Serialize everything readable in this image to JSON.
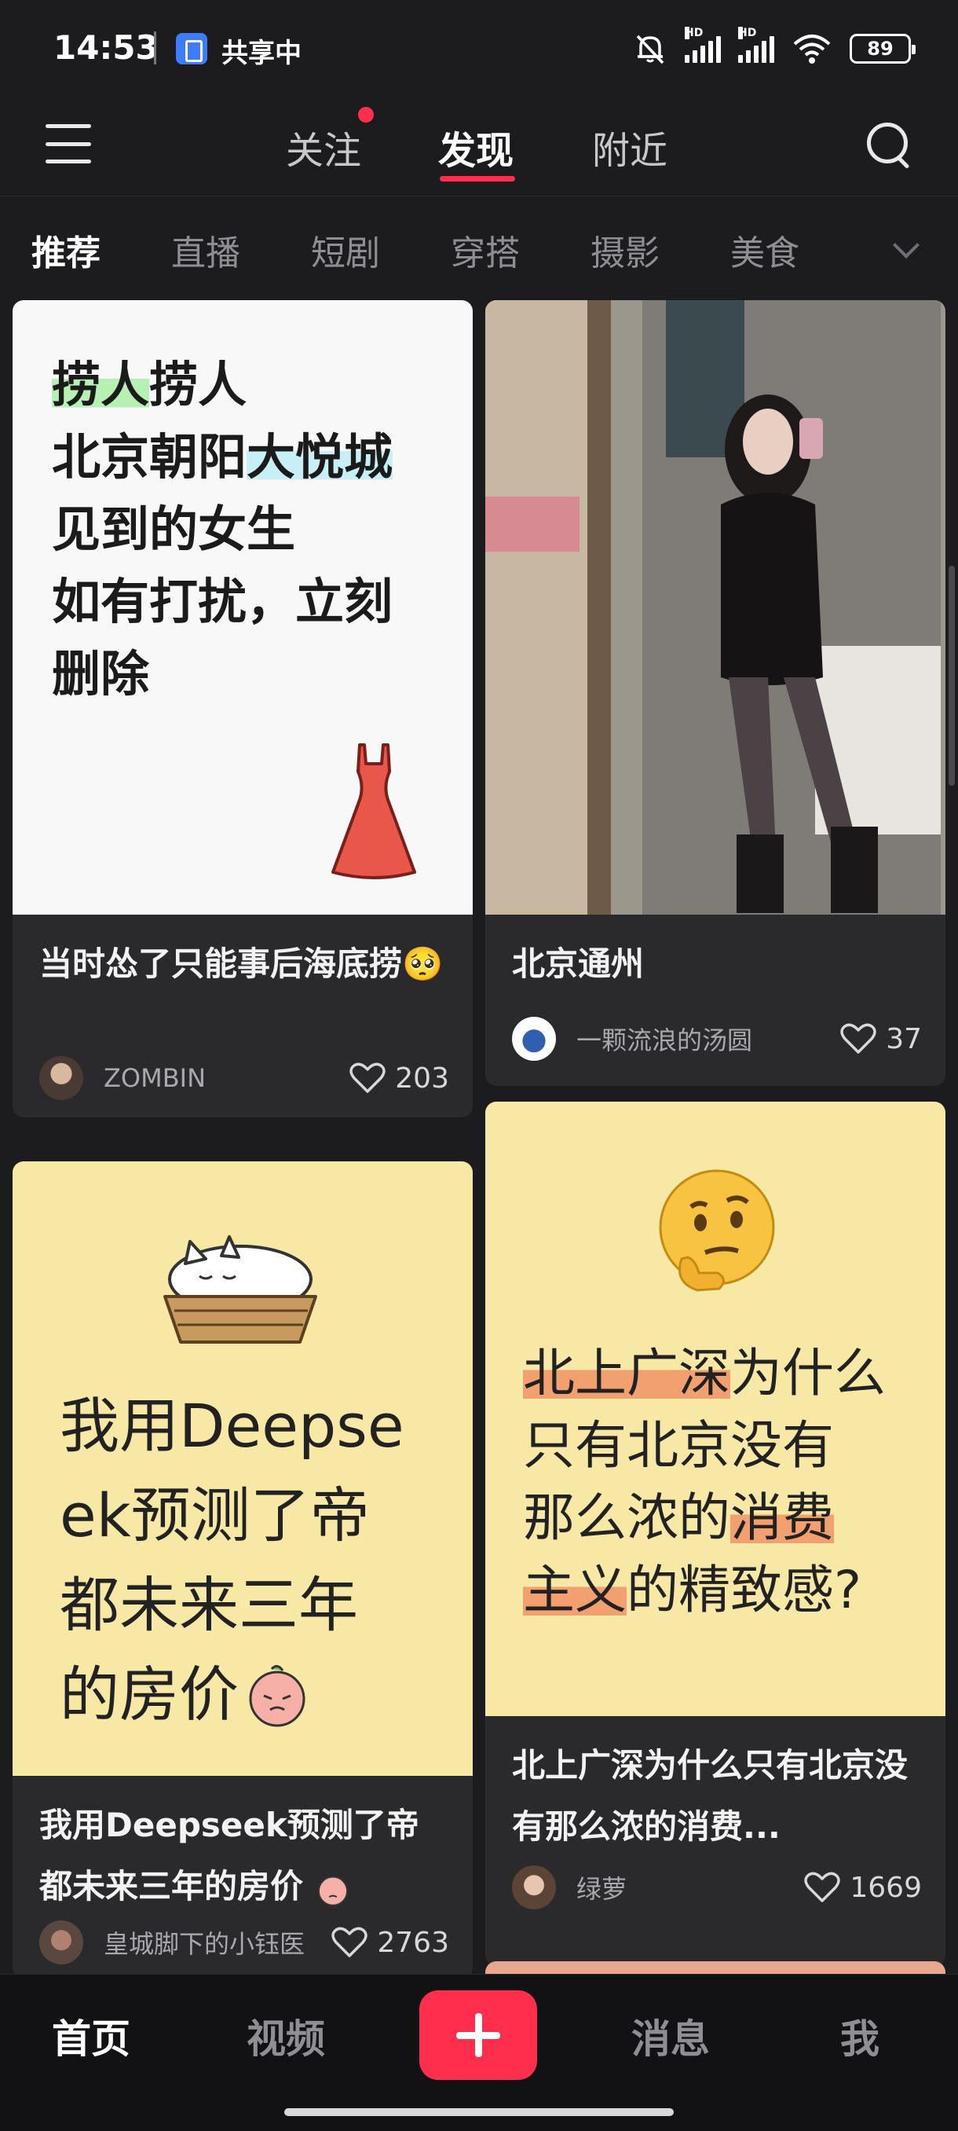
{
  "status_bar": {
    "time": "14:53",
    "share_label": "共享中",
    "battery": "89",
    "signal_tag": "HD",
    "icons": [
      "share-screen-icon",
      "mute-bell-icon",
      "signal-hd-icon",
      "signal-hd-icon",
      "wifi-icon",
      "battery-icon"
    ]
  },
  "top_nav": {
    "tabs": [
      {
        "label": "关注",
        "active": false,
        "has_dot": true
      },
      {
        "label": "发现",
        "active": true
      },
      {
        "label": "附近",
        "active": false
      }
    ],
    "accent_color": "#ff2e4d"
  },
  "categories": {
    "items": [
      "推荐",
      "直播",
      "短剧",
      "穿搭",
      "摄影",
      "美食"
    ],
    "active_index": 0
  },
  "feed": {
    "cards": [
      {
        "cover_lines": [
          "捞人捞人",
          "北京朝阳大悦城",
          "见到的女生",
          "如有打扰，立刻",
          "删除"
        ],
        "title": "当时怂了只能事后海底捞🥺",
        "author": "ZOMBIN",
        "likes": "203"
      },
      {
        "title": "北京通州",
        "author": "一颗流浪的汤圆",
        "likes": "37"
      },
      {
        "cover_lines": [
          "我用Deepse",
          "ek预测了帝",
          "都未来三年",
          "的房价"
        ],
        "title": "我用Deepseek预测了帝都未来三年的房价",
        "author": "皇城脚下的小钰医",
        "likes": "2763"
      },
      {
        "cover_lines": [
          "北上广深为什么",
          "只有北京没有",
          "那么浓的消费",
          "主义的精致感?"
        ],
        "title": "北上广深为什么只有北京没有那么浓的消费...",
        "author": "绿萝",
        "likes": "1669"
      }
    ]
  },
  "bottom_bar": {
    "items": [
      "首页",
      "视频",
      "消息",
      "我"
    ],
    "active_index": 0,
    "plus_color": "#ff2e4d"
  }
}
